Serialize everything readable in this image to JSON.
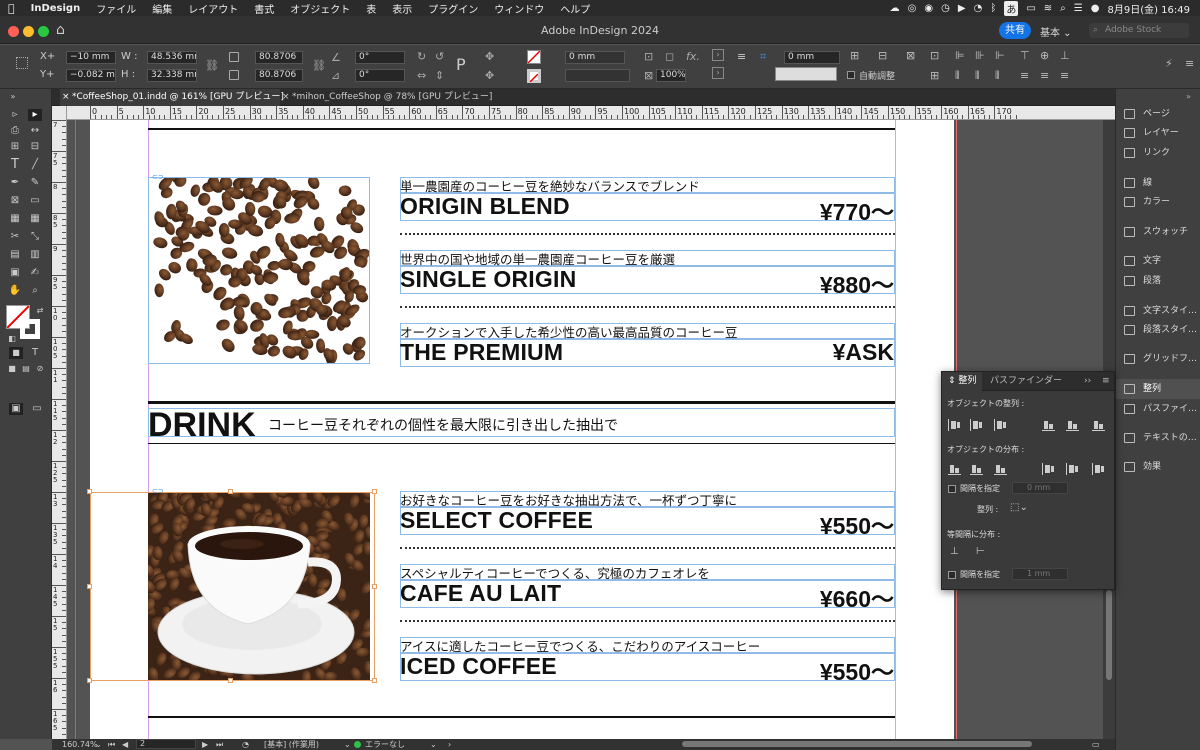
{
  "menubar": {
    "app": "InDesign",
    "items": [
      "ファイル",
      "編集",
      "レイアウト",
      "書式",
      "オブジェクト",
      "表",
      "表示",
      "プラグイン",
      "ウィンドウ",
      "ヘルプ"
    ],
    "input_mode": "あ",
    "datetime": "8月9日(金) 16:49"
  },
  "window": {
    "title": "Adobe InDesign 2024",
    "share_label": "共有",
    "workspace": "基本",
    "stock_search": "Adobe Stock"
  },
  "control": {
    "x_label": "X+",
    "y_label": "Y+",
    "x_value": "−10 mm",
    "y_value": "−0.082 mm",
    "w_label": "W :",
    "h_label": "H :",
    "w_value": "48.536 mm",
    "h_value": "32.338 mm",
    "scale_x": "80.8706",
    "scale_y": "80.8706",
    "rotate": "0°",
    "shear": "0°",
    "stroke_weight": "0 mm",
    "opacity": "100%",
    "inset": "0 mm",
    "autofit_label": "自動調整"
  },
  "tabs": [
    {
      "label": "*CoffeeShop_01.indd @ 161% [GPU プレビュー]",
      "close": "×"
    },
    {
      "label": "*mihon_CoffeeShop @ 78% [GPU プレビュー]",
      "close": "×"
    }
  ],
  "ruler": {
    "h_marks": [
      "0",
      "5",
      "10",
      "15",
      "20",
      "25",
      "30",
      "35",
      "40",
      "45",
      "50",
      "55",
      "60",
      "65",
      "70",
      "75",
      "80",
      "85",
      "90",
      "95",
      "100",
      "105",
      "110",
      "115",
      "120",
      "125",
      "130",
      "135",
      "140",
      "145",
      "150",
      "155",
      "160",
      "165",
      "170"
    ],
    "v_marks": [
      "7",
      "7 5",
      "8",
      "8 5",
      "9",
      "9 5",
      "1 0",
      "1 0 5",
      "1 1",
      "1 1 5",
      "1 2",
      "1 2 5",
      "1 3",
      "1 3 5",
      "1 4",
      "1 4 5",
      "1 5",
      "1 5 5",
      "1 6",
      "1 6 5"
    ]
  },
  "document": {
    "coffee_items": [
      {
        "sub": "単一農園産のコーヒー豆を絶妙なバランスでブレンド",
        "name": "ORIGIN BLEND",
        "price": "¥770〜"
      },
      {
        "sub": "世界中の国や地域の単一農園産コーヒー豆を厳選",
        "name": "SINGLE ORIGIN",
        "price": "¥880〜"
      },
      {
        "sub": "オークションで入手した希少性の高い最高品質のコーヒー豆",
        "name": "THE PREMIUM",
        "price": "¥ASK"
      }
    ],
    "drink_heading": "DRINK",
    "drink_tagline": "コーヒー豆それぞれの個性を最大限に引き出した抽出で",
    "drink_items": [
      {
        "sub": "お好きなコーヒー豆をお好きな抽出方法で、一杯ずつ丁寧に",
        "name": "SELECT COFFEE",
        "price": "¥550〜"
      },
      {
        "sub": "スペシャルティコーヒーでつくる、究極のカフェオレを",
        "name": "CAFE AU LAIT",
        "price": "¥660〜"
      },
      {
        "sub": "アイスに適したコーヒー豆でつくる、こだわりのアイスコーヒー",
        "name": "ICED COFFEE",
        "price": "¥550〜"
      }
    ]
  },
  "dock": {
    "items": [
      "ページ",
      "レイヤー",
      "リンク",
      "線",
      "カラー",
      "スウォッチ",
      "文字",
      "段落",
      "文字スタイ…",
      "段落スタイ…",
      "グリッドフ…",
      "整列",
      "パスファイ…",
      "テキストの…",
      "効果"
    ]
  },
  "align_panel": {
    "tab_align": "整列",
    "tab_pathfinder": "パスファインダー",
    "sec_align": "オブジェクトの整列 :",
    "sec_distribute": "オブジェクトの分布 :",
    "spacing_label": "間隔を指定",
    "spacing_value": "0 mm",
    "align_to_label": "整列 :",
    "sec_distribute_spacing": "等間隔に分布 :",
    "spacing_label2": "間隔を指定",
    "spacing_value2": "1 mm"
  },
  "status": {
    "zoom": "160.74%",
    "page": "2",
    "style": "[基本] (作業用)",
    "preflight": "エラーなし"
  },
  "colors": {
    "accent": "#1473e6",
    "ok": "#2fbf4a",
    "frame": "#8fbbe8",
    "selection": "#e8a064"
  }
}
